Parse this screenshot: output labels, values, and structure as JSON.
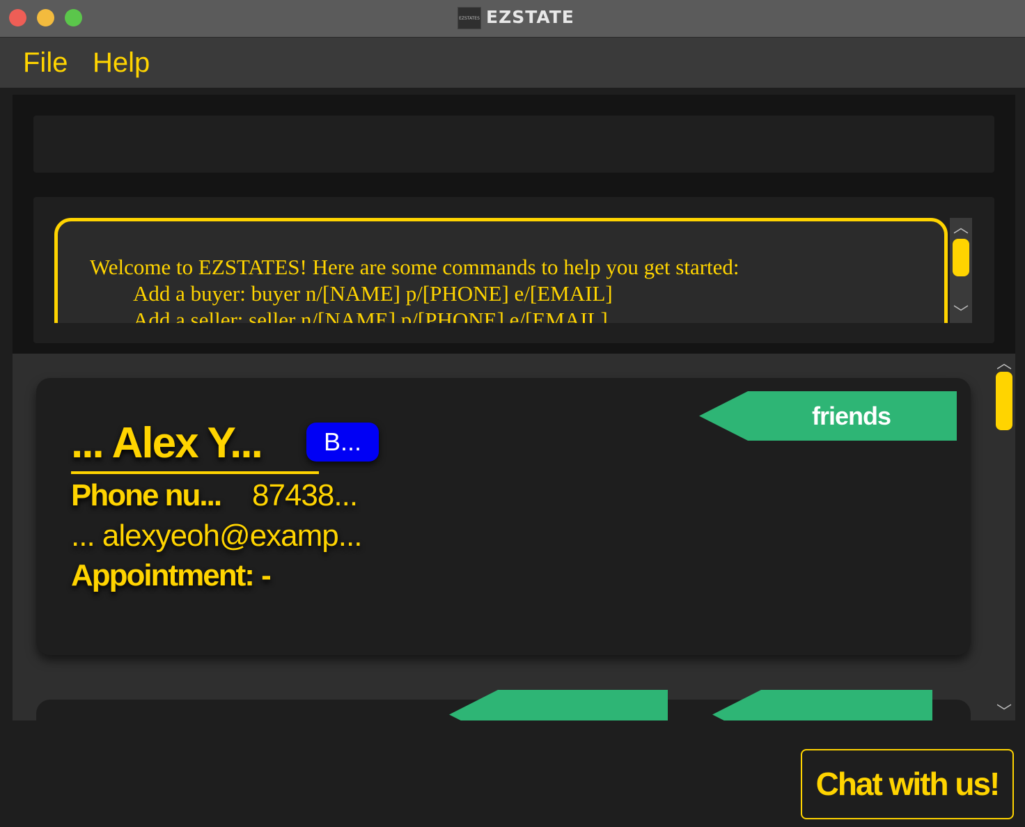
{
  "window": {
    "title": "EZSTATE",
    "app_icon_text": "EZSTATES"
  },
  "menu": {
    "file": "File",
    "help": "Help"
  },
  "command_box": {
    "value": ""
  },
  "result_display": {
    "text": "Welcome to EZSTATES! Here are some commands to help you get started:\n\tAdd a buyer: buyer n/[NAME] p/[PHONE] e/[EMAIL]\n\tAdd a seller: seller n/[NAME] p/[PHONE] e/[EMAIL]"
  },
  "client_list": {
    "cards": [
      {
        "name": "... Alex Y...",
        "role_badge": "B...",
        "tag": "friends",
        "phone_label": "Phone nu...",
        "phone_value": "87438...",
        "email_text": "... alexyeoh@examp...",
        "appointment_label": "Appointment:",
        "appointment_value": "-"
      }
    ]
  },
  "colors": {
    "accent": "#ffd400",
    "tag": "#2eb575",
    "role_badge": "#0000f5",
    "background": "#1e1e1e"
  },
  "icons": {
    "scroll_up": "chevron-up-icon",
    "scroll_down": "chevron-down-icon"
  },
  "footer": {
    "status": "",
    "chat_button": "Chat with us!"
  }
}
